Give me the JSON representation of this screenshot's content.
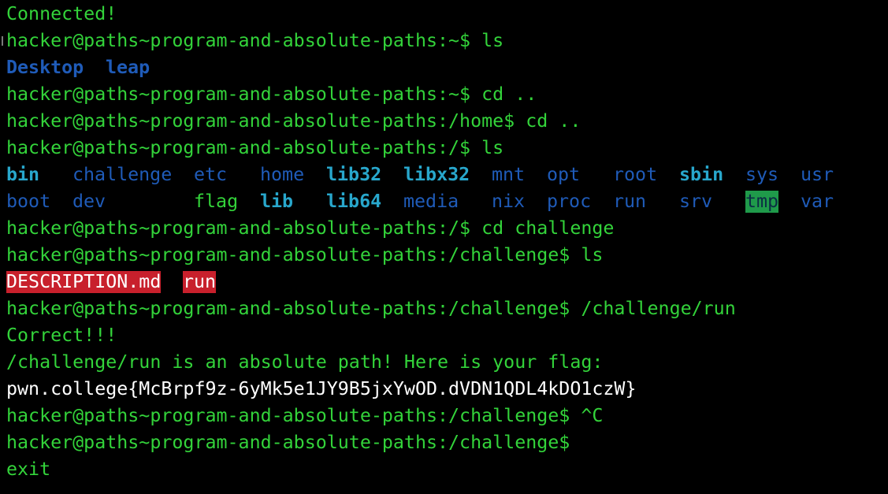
{
  "terminal": {
    "connected_message": "Connected!",
    "lines": [
      {
        "prompt": "hacker@paths~program-and-absolute-paths:~$",
        "command": "ls"
      },
      {
        "prompt": "hacker@paths~program-and-absolute-paths:~$",
        "command": "cd .."
      },
      {
        "prompt": "hacker@paths~program-and-absolute-paths:/home$",
        "command": "cd .."
      },
      {
        "prompt": "hacker@paths~program-and-absolute-paths:/$",
        "command": "ls"
      },
      {
        "prompt": "hacker@paths~program-and-absolute-paths:/$",
        "command": "cd challenge"
      },
      {
        "prompt": "hacker@paths~program-and-absolute-paths:/challenge$",
        "command": "ls"
      },
      {
        "prompt": "hacker@paths~program-and-absolute-paths:/challenge$",
        "command": "/challenge/run"
      },
      {
        "prompt": "hacker@paths~program-and-absolute-paths:/challenge$",
        "command": "^C"
      },
      {
        "prompt": "hacker@paths~program-and-absolute-paths:/challenge$",
        "command": ""
      }
    ],
    "home_listing": [
      "Desktop",
      "leap"
    ],
    "root_listing_row1": [
      "bin",
      "challenge",
      "etc",
      "home",
      "lib32",
      "libx32",
      "mnt",
      "opt",
      "root",
      "sbin",
      "sys",
      "usr"
    ],
    "root_listing_row2": [
      "boot",
      "dev",
      "flag",
      "lib",
      "lib64",
      "media",
      "nix",
      "proc",
      "run",
      "srv",
      "tmp",
      "var"
    ],
    "challenge_listing": [
      "DESCRIPTION.md",
      "run"
    ],
    "output": {
      "correct": "Correct!!!",
      "explanation": "/challenge/run is an absolute path! Here is your flag:",
      "flag": "pwn.college{McBrpf9z-6yMk5e1JY9B5jxYwOD.dVDN1QDL4kDO1czW}"
    },
    "exit_text": "exit",
    "colors": {
      "background": "#000000",
      "prompt_green": "#33d33a",
      "directory_blue": "#1f5bb8",
      "symlink_cyan": "#28a7cc",
      "executable_highlight_red": "#c8202c",
      "sticky_dir_highlight_green": "#1f9a4a"
    }
  }
}
